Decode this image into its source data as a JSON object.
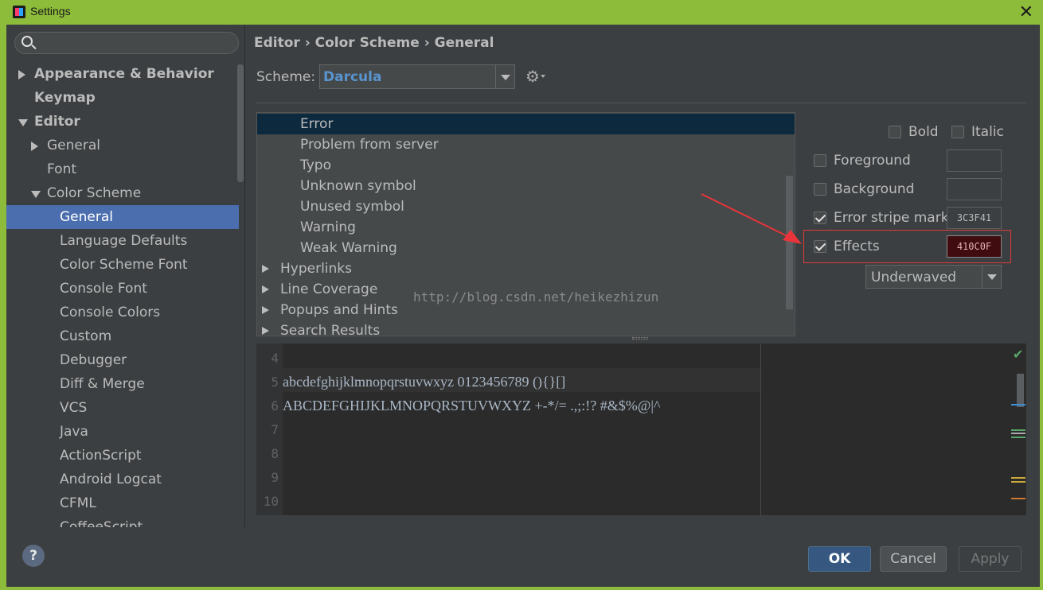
{
  "window": {
    "title": "Settings"
  },
  "search": {
    "placeholder": ""
  },
  "tree": [
    {
      "label": "Appearance & Behavior",
      "level": 0,
      "bold": true,
      "arrow": "right"
    },
    {
      "label": "Keymap",
      "level": 0,
      "bold": true,
      "arrow": "none"
    },
    {
      "label": "Editor",
      "level": 0,
      "bold": true,
      "arrow": "down"
    },
    {
      "label": "General",
      "level": 1,
      "bold": false,
      "arrow": "right"
    },
    {
      "label": "Font",
      "level": 1,
      "bold": false,
      "arrow": "none"
    },
    {
      "label": "Color Scheme",
      "level": 1,
      "bold": false,
      "arrow": "down"
    },
    {
      "label": "General",
      "level": 2,
      "bold": false,
      "arrow": "none",
      "selected": true
    },
    {
      "label": "Language Defaults",
      "level": 2,
      "bold": false,
      "arrow": "none"
    },
    {
      "label": "Color Scheme Font",
      "level": 2,
      "bold": false,
      "arrow": "none"
    },
    {
      "label": "Console Font",
      "level": 2,
      "bold": false,
      "arrow": "none"
    },
    {
      "label": "Console Colors",
      "level": 2,
      "bold": false,
      "arrow": "none"
    },
    {
      "label": "Custom",
      "level": 2,
      "bold": false,
      "arrow": "none"
    },
    {
      "label": "Debugger",
      "level": 2,
      "bold": false,
      "arrow": "none"
    },
    {
      "label": "Diff & Merge",
      "level": 2,
      "bold": false,
      "arrow": "none"
    },
    {
      "label": "VCS",
      "level": 2,
      "bold": false,
      "arrow": "none"
    },
    {
      "label": "Java",
      "level": 2,
      "bold": false,
      "arrow": "none"
    },
    {
      "label": "ActionScript",
      "level": 2,
      "bold": false,
      "arrow": "none"
    },
    {
      "label": "Android Logcat",
      "level": 2,
      "bold": false,
      "arrow": "none"
    },
    {
      "label": "CFML",
      "level": 2,
      "bold": false,
      "arrow": "none"
    },
    {
      "label": "CoffeeScript",
      "level": 2,
      "bold": false,
      "arrow": "none"
    }
  ],
  "header": {
    "breadcrumb": "Editor › Color Scheme › General"
  },
  "scheme": {
    "label": "Scheme:",
    "value": "Darcula"
  },
  "attributes": [
    {
      "label": "Error",
      "indent": 2,
      "arrow": false,
      "selected": true
    },
    {
      "label": "Problem from server",
      "indent": 2,
      "arrow": false
    },
    {
      "label": "Typo",
      "indent": 2,
      "arrow": false
    },
    {
      "label": "Unknown symbol",
      "indent": 2,
      "arrow": false
    },
    {
      "label": "Unused symbol",
      "indent": 2,
      "arrow": false
    },
    {
      "label": "Warning",
      "indent": 2,
      "arrow": false
    },
    {
      "label": "Weak Warning",
      "indent": 2,
      "arrow": false
    },
    {
      "label": "Hyperlinks",
      "indent": 1,
      "arrow": true
    },
    {
      "label": "Line Coverage",
      "indent": 1,
      "arrow": true
    },
    {
      "label": "Popups and Hints",
      "indent": 1,
      "arrow": true
    },
    {
      "label": "Search Results",
      "indent": 1,
      "arrow": true
    }
  ],
  "watermark": "http://blog.csdn.net/heikezhizun",
  "options": {
    "bold": {
      "label": "Bold",
      "checked": false
    },
    "italic": {
      "label": "Italic",
      "checked": false
    },
    "foreground": {
      "label": "Foreground",
      "checked": false,
      "value": ""
    },
    "background": {
      "label": "Background",
      "checked": false,
      "value": ""
    },
    "error_stripe": {
      "label": "Error stripe mark",
      "checked": true,
      "value": "3C3F41"
    },
    "effects": {
      "label": "Effects",
      "checked": true,
      "value": "410C0F",
      "swatch_color": "#410c0f"
    },
    "effect_type": "Underwaved"
  },
  "preview": {
    "lines": [
      {
        "no": "4",
        "text": ""
      },
      {
        "no": "5",
        "text": "abcdefghijklmnopqrstuvwxyz 0123456789 (){}[]"
      },
      {
        "no": "6",
        "text": "ABCDEFGHIJKLMNOPQRSTUVWXYZ +-*/= .,;:!? #&$%@|^"
      },
      {
        "no": "7",
        "text": ""
      },
      {
        "no": "8",
        "text": ""
      },
      {
        "no": "9",
        "text": ""
      },
      {
        "no": "10",
        "text": ""
      }
    ]
  },
  "buttons": {
    "help": "?",
    "ok": "OK",
    "cancel": "Cancel",
    "apply": "Apply"
  },
  "colors": {
    "accent": "#4b6eaf",
    "frame": "#8dbb3a",
    "highlight": "#e03b3b"
  }
}
